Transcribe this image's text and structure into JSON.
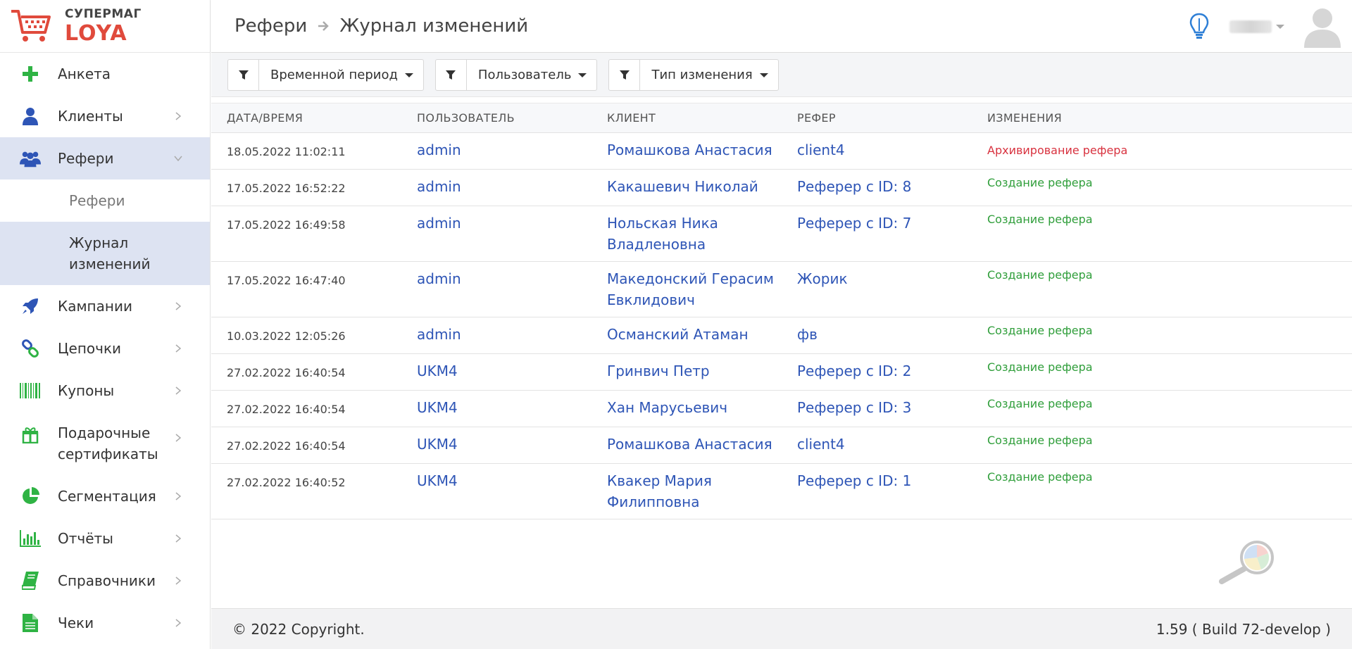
{
  "logo": {
    "top": "СУПЕРМАГ",
    "bottom": "LOYA"
  },
  "sidebar": {
    "items": [
      {
        "label": "Анкета",
        "icon": "plus-icon"
      },
      {
        "label": "Клиенты",
        "icon": "user-icon"
      },
      {
        "label": "Рефери",
        "icon": "users-icon"
      },
      {
        "label": "Кампании",
        "icon": "rocket-icon"
      },
      {
        "label": "Цепочки",
        "icon": "chain-icon"
      },
      {
        "label": "Купоны",
        "icon": "barcode-icon"
      },
      {
        "label": "Подарочные сертификаты",
        "icon": "gift-icon"
      },
      {
        "label": "Сегментация",
        "icon": "pie-icon"
      },
      {
        "label": "Отчёты",
        "icon": "bar-chart-icon"
      },
      {
        "label": "Справочники",
        "icon": "book-icon"
      },
      {
        "label": "Чеки",
        "icon": "document-icon"
      }
    ],
    "sub_items": [
      {
        "label": "Рефери"
      },
      {
        "label": "Журнал изменений"
      }
    ]
  },
  "header": {
    "breadcrumb": [
      "Рефери",
      "Журнал изменений"
    ]
  },
  "filters": [
    {
      "label": "Временной период"
    },
    {
      "label": "Пользователь"
    },
    {
      "label": "Тип изменения"
    }
  ],
  "table": {
    "columns": [
      "Дата/время",
      "Пользователь",
      "Клиент",
      "Рефер",
      "Изменения"
    ],
    "rows": [
      {
        "date": "18.05.2022 11:02:11",
        "user": "admin",
        "client": "Ромашкова Анастасия",
        "referer": "client4",
        "change": "Архивирование рефера",
        "type": "archive"
      },
      {
        "date": "17.05.2022 16:52:22",
        "user": "admin",
        "client": "Какашевич Николай",
        "referer": "Реферер с ID: 8",
        "change": "Создание рефера",
        "type": "create"
      },
      {
        "date": "17.05.2022 16:49:58",
        "user": "admin",
        "client": "Нольская Ника Владленовна",
        "referer": "Реферер с ID: 7",
        "change": "Создание рефера",
        "type": "create"
      },
      {
        "date": "17.05.2022 16:47:40",
        "user": "admin",
        "client": "Македонский Герасим Евклидович",
        "referer": "Жорик",
        "change": "Создание рефера",
        "type": "create"
      },
      {
        "date": "10.03.2022 12:05:26",
        "user": "admin",
        "client": "Османский Атаман",
        "referer": "фв",
        "change": "Создание рефера",
        "type": "create"
      },
      {
        "date": "27.02.2022 16:40:54",
        "user": "UKM4",
        "client": "Гринвич Петр",
        "referer": "Реферер с ID: 2",
        "change": "Создание рефера",
        "type": "create"
      },
      {
        "date": "27.02.2022 16:40:54",
        "user": "UKM4",
        "client": "Хан Марусьевич",
        "referer": "Реферер с ID: 3",
        "change": "Создание рефера",
        "type": "create"
      },
      {
        "date": "27.02.2022 16:40:54",
        "user": "UKM4",
        "client": "Ромашкова Анастасия",
        "referer": "client4",
        "change": "Создание рефера",
        "type": "create"
      },
      {
        "date": "27.02.2022 16:40:52",
        "user": "UKM4",
        "client": "Квакер Мария Филипповна",
        "referer": "Реферер с ID: 1",
        "change": "Создание рефера",
        "type": "create"
      }
    ]
  },
  "footer": {
    "copyright": "© 2022 Copyright.",
    "version": "1.59 ( Build 72-develop )"
  },
  "colors": {
    "link": "#2e55b6",
    "create": "#2f9e3a",
    "archive": "#d8323f",
    "active_bg": "#dde3f2",
    "brand": "#e04a3c"
  }
}
